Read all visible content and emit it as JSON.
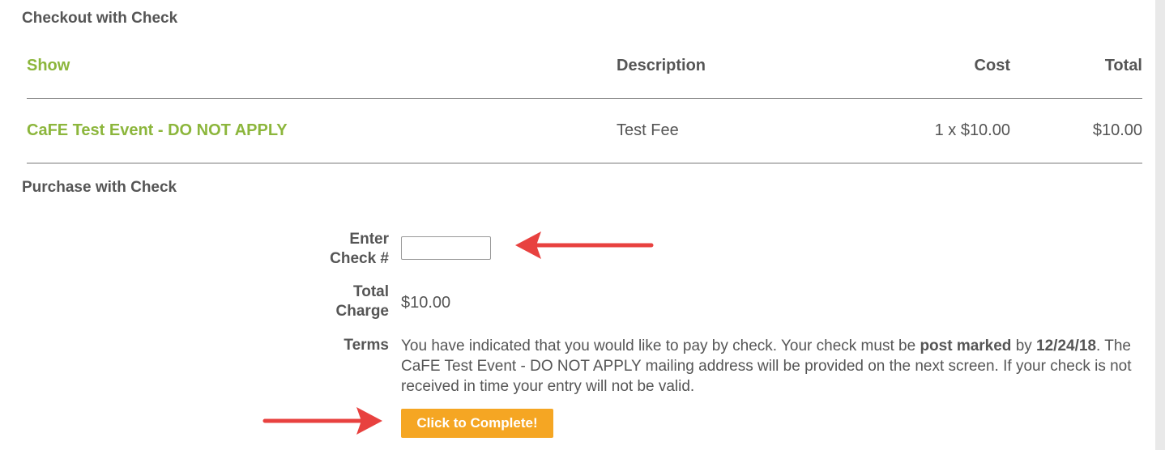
{
  "checkout": {
    "heading": "Checkout with Check",
    "columns": [
      "Show",
      "Description",
      "Cost",
      "Total"
    ],
    "rows": [
      {
        "show": "CaFE Test Event - DO NOT APPLY",
        "description": "Test Fee",
        "cost": "1 x $10.00",
        "total": "$10.00"
      }
    ]
  },
  "purchase": {
    "heading": "Purchase with Check",
    "check_label_line1": "Enter",
    "check_label_line2": "Check #",
    "check_value": "",
    "charge_label_line1": "Total",
    "charge_label_line2": "Charge",
    "charge_value": "$10.00",
    "terms_label": "Terms",
    "terms_part1": "You have indicated that you would like to pay by check. Your check must be ",
    "terms_bold1": "post marked",
    "terms_part2": " by ",
    "terms_bold2": "12/24/18",
    "terms_part3": ". The CaFE Test Event - DO NOT APPLY mailing address will be provided on the next screen. If your check is not received in time your entry will not be valid.",
    "button_label": "Click to Complete!"
  },
  "colors": {
    "accent_green": "#8cb63c",
    "button_orange": "#f5a623",
    "annotation_arrow": "#e8413f"
  },
  "annotations": [
    "red-arrow-to-check-input",
    "red-arrow-to-complete-button"
  ]
}
